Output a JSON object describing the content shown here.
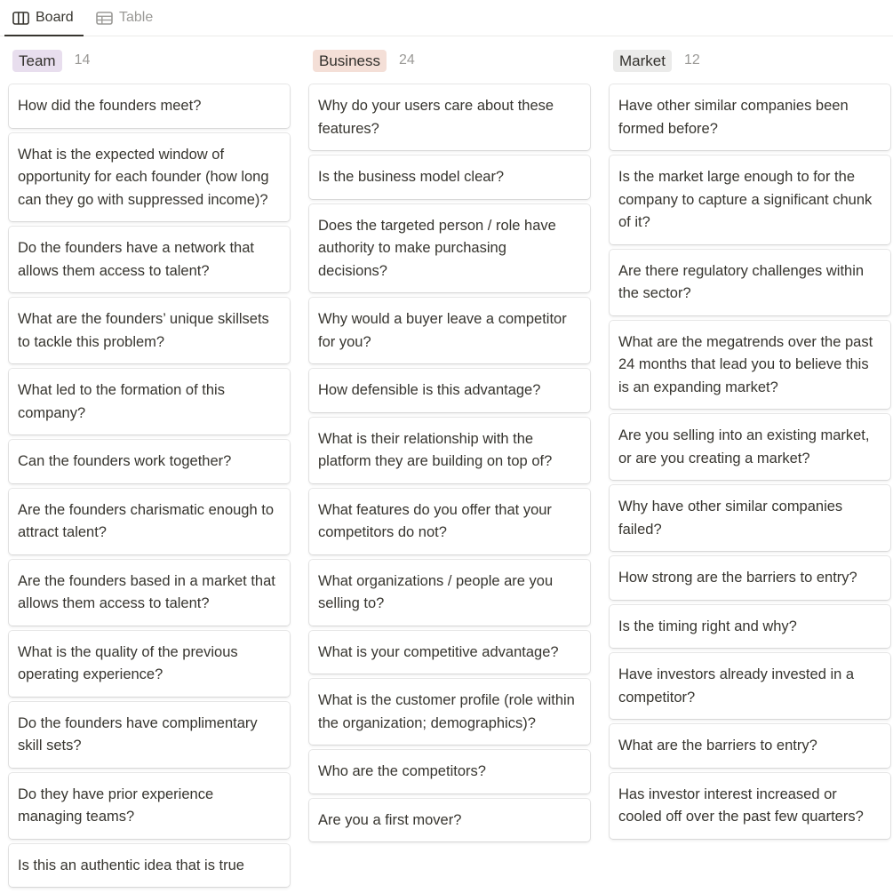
{
  "views": [
    {
      "label": "Board",
      "icon": "board-icon",
      "active": true
    },
    {
      "label": "Table",
      "icon": "table-icon",
      "active": false
    }
  ],
  "colors": {
    "team_pill": "#e8deee",
    "business_pill": "#f4dfd7",
    "market_pill": "#ebebea",
    "text": "#37352f",
    "muted": "#9b9a97"
  },
  "columns": [
    {
      "title": "Team",
      "count": "14",
      "cards": [
        "How did the founders meet?",
        "What is the expected window of opportunity for each founder (how long can they go with suppressed income)?",
        "Do the founders have a network that allows them access to talent?",
        "What are the founders’ unique skillsets to tackle this problem?",
        "What led to the formation of this company?",
        "Can the founders work together?",
        "Are the founders charismatic enough to attract talent?",
        "Are the founders based in a market that allows them access to talent?",
        "What is the quality of the previous operating experience?",
        "Do the founders have complimentary skill sets?",
        "Do they have prior experience managing teams?",
        "Is this an authentic idea that is true"
      ]
    },
    {
      "title": "Business",
      "count": "24",
      "cards": [
        "Why do your users care about these features?",
        "Is the business model clear?",
        "Does the targeted person / role have authority to make purchasing decisions?",
        "Why would a buyer leave a competitor for you?",
        "How defensible is this advantage?",
        "What is their relationship with the platform they are building on top of?",
        "What features do you offer that your competitors do not?",
        "What organizations / people are you selling to?",
        "What is your competitive advantage?",
        "What is the customer profile (role within the organization; demographics)?",
        "Who are the competitors?",
        "Are you a first mover?"
      ]
    },
    {
      "title": "Market",
      "count": "12",
      "cards": [
        "Have other similar companies been formed before?",
        "Is the market large enough to for the company to capture a significant chunk of it?",
        "Are there regulatory challenges within the sector?",
        "What are the megatrends over the past 24 months that lead you to believe this is an expanding market?",
        "Are you selling into an existing market, or are you creating a market?",
        "Why have other similar companies failed?",
        "How strong are the barriers to entry?",
        "Is the timing right and why?",
        "Have investors already invested in a competitor?",
        "What are the barriers to entry?",
        "Has investor interest increased or cooled off over the past few quarters?"
      ]
    }
  ]
}
